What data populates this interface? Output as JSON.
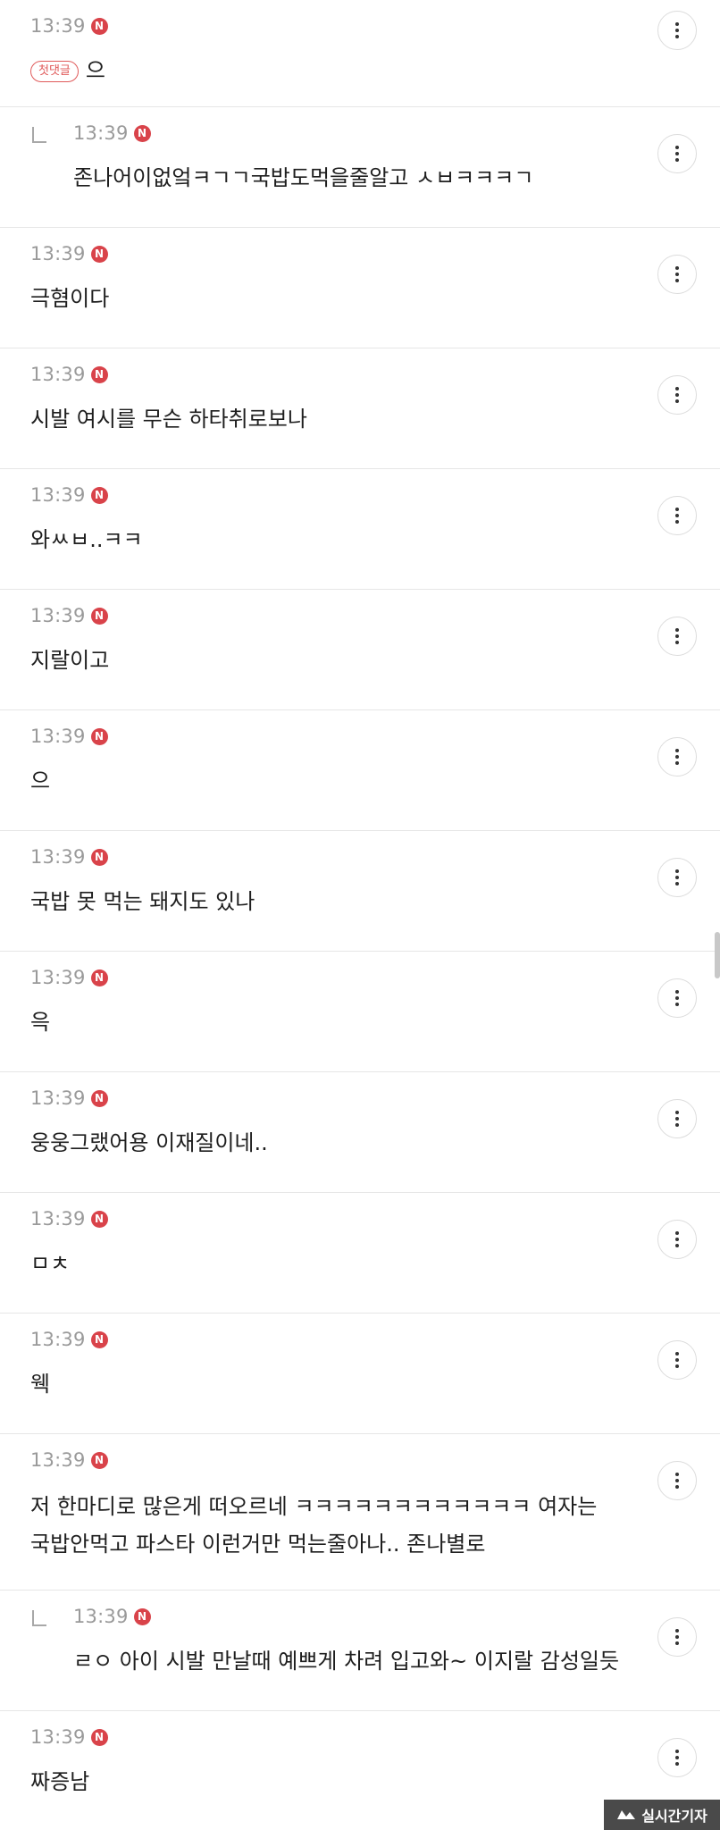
{
  "comments": [
    {
      "time": "13:39",
      "badge": "N",
      "first_badge": "첫댓글",
      "text": "으"
    },
    {
      "time": "13:39",
      "badge": "N",
      "text": "존나어이없엌ㅋㄱㄱ국밥도먹을줄알고 ㅅㅂㅋㅋㅋㄱ"
    },
    {
      "time": "13:39",
      "badge": "N",
      "text": "극혐이다"
    },
    {
      "time": "13:39",
      "badge": "N",
      "text": "시발 여시를 무슨 하타취로보나"
    },
    {
      "time": "13:39",
      "badge": "N",
      "text": "와ㅆㅂ..ㅋㅋ"
    },
    {
      "time": "13:39",
      "badge": "N",
      "text": "지랄이고"
    },
    {
      "time": "13:39",
      "badge": "N",
      "text": "으"
    },
    {
      "time": "13:39",
      "badge": "N",
      "text": "국밥 못 먹는 돼지도 있나"
    },
    {
      "time": "13:39",
      "badge": "N",
      "text": "윽"
    },
    {
      "time": "13:39",
      "badge": "N",
      "text": "웅웅그랬어용 이재질이네.."
    },
    {
      "time": "13:39",
      "badge": "N",
      "text": "ㅁㅊ"
    },
    {
      "time": "13:39",
      "badge": "N",
      "text": "웩"
    },
    {
      "time": "13:39",
      "badge": "N",
      "text": "저 한마디로 많은게 떠오르네 ㅋㅋㅋㅋㅋㅋㅋㅋㅋㅋㅋㅋ 여자는 국밥안먹고 파스타 이런거만 먹는줄아나.. 존나별로"
    },
    {
      "time": "13:39",
      "badge": "N",
      "text": "ㄹㅇ 아이 시발 만날때 예쁘게 차려 입고와~ 이지랄 감성일듯"
    },
    {
      "time": "13:39",
      "badge": "N",
      "text": "짜증남"
    }
  ],
  "watermark": "실시간기자"
}
